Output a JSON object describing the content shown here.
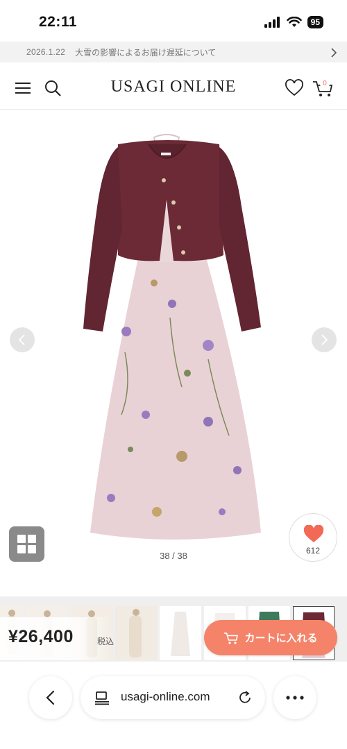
{
  "status_bar": {
    "time": "22:11",
    "battery": "95"
  },
  "notice": {
    "date": "2026.1.22",
    "text": "大雪の影響によるお届け遅延について"
  },
  "header": {
    "brand": "USAGI ONLINE",
    "cart_count": "0"
  },
  "gallery": {
    "counter": "38 / 38",
    "favorite_count": "612"
  },
  "purchase": {
    "price": "¥26,400",
    "tax_label": "税込",
    "cart_button_label": "カートに入れる"
  },
  "browser": {
    "url": "usagi-online.com"
  },
  "colors": {
    "accent": "#f4836a",
    "heart": "#f26a55",
    "cardigan": "#6b2a35",
    "dress": "#e9d2d6"
  },
  "icons": [
    "menu-icon",
    "search-icon",
    "heart-icon",
    "cart-icon",
    "chevron-left-icon",
    "chevron-right-icon",
    "grid-icon",
    "back-icon",
    "reload-icon",
    "more-icon",
    "tabs-icon"
  ]
}
